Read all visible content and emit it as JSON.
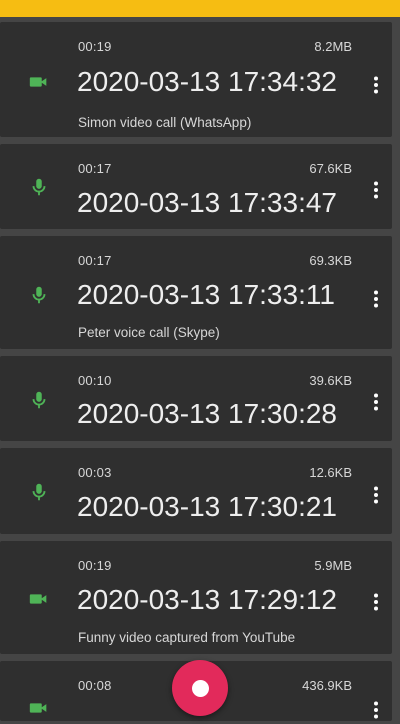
{
  "colors": {
    "topbar": "#f6bd12",
    "card": "#2f2f2f",
    "icon": "#4fb457",
    "record_button": "#e22a5b"
  },
  "recordings": [
    {
      "icon": "video-icon",
      "duration": "00:19",
      "size": "8.2MB",
      "timestamp": "2020-03-13 17:34:32",
      "note": "Simon video call (WhatsApp)"
    },
    {
      "icon": "mic-icon",
      "duration": "00:17",
      "size": "67.6KB",
      "timestamp": "2020-03-13 17:33:47",
      "note": ""
    },
    {
      "icon": "mic-icon",
      "duration": "00:17",
      "size": "69.3KB",
      "timestamp": "2020-03-13 17:33:11",
      "note": "Peter voice call (Skype)"
    },
    {
      "icon": "mic-icon",
      "duration": "00:10",
      "size": "39.6KB",
      "timestamp": "2020-03-13 17:30:28",
      "note": ""
    },
    {
      "icon": "mic-icon",
      "duration": "00:03",
      "size": "12.6KB",
      "timestamp": "2020-03-13 17:30:21",
      "note": ""
    },
    {
      "icon": "video-icon",
      "duration": "00:19",
      "size": "5.9MB",
      "timestamp": "2020-03-13 17:29:12",
      "note": "Funny video captured from YouTube"
    },
    {
      "icon": "video-icon",
      "duration": "00:08",
      "size": "436.9KB",
      "timestamp": "",
      "note": ""
    }
  ],
  "fab": {
    "icon": "record-icon"
  }
}
